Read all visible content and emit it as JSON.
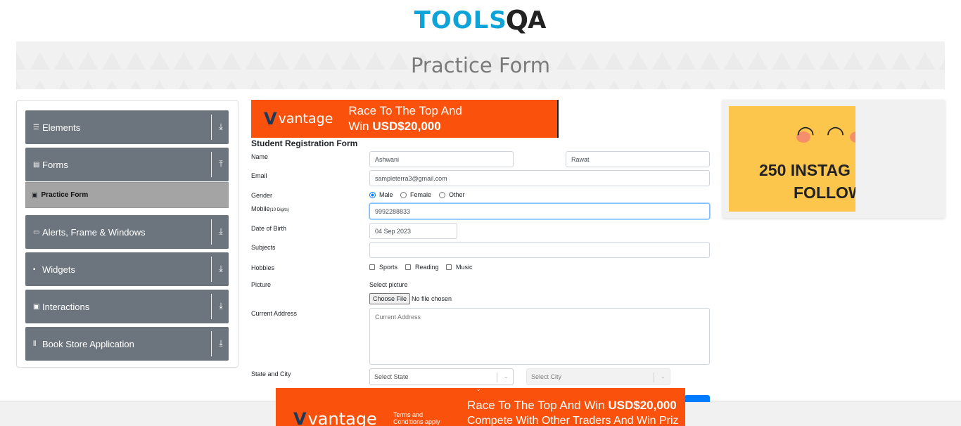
{
  "logo": {
    "part1": "TOOLS",
    "part2": "Q",
    "part3": "A"
  },
  "banner": {
    "title": "Practice Form"
  },
  "sidebar": {
    "groups": [
      {
        "label": "Elements",
        "icon": "list-icon",
        "arrow": "⤓"
      },
      {
        "label": "Forms",
        "icon": "form-icon",
        "arrow": "⤒"
      },
      {
        "label": "Alerts, Frame & Windows",
        "icon": "window-icon",
        "arrow": "⤓"
      },
      {
        "label": "Widgets",
        "icon": "widgets-icon",
        "arrow": "⤓"
      },
      {
        "label": "Interactions",
        "icon": "interactions-icon",
        "arrow": "⤓"
      },
      {
        "label": "Book Store Application",
        "icon": "books-icon",
        "arrow": "⤓"
      }
    ],
    "active_item": "Practice Form"
  },
  "ad_top": {
    "brand": "vantage",
    "line1": "Race To The Top And",
    "line2_prefix": "Win ",
    "line2_bold": "USD$20,000"
  },
  "form": {
    "title": "Student Registration Form",
    "name_label": "Name",
    "first_name": "Ashwani",
    "last_name": "Rawat",
    "email_label": "Email",
    "email": "sampleterra3@gmail.com",
    "gender_label": "Gender",
    "genders": [
      "Male",
      "Female",
      "Other"
    ],
    "gender_selected": "Male",
    "mobile_label": "Mobile",
    "mobile_hint": "(10 Digits)",
    "mobile": "9992288833",
    "dob_label": "Date of Birth",
    "dob": "04 Sep 2023",
    "subjects_label": "Subjects",
    "hobbies_label": "Hobbies",
    "hobbies": [
      "Sports",
      "Reading",
      "Music"
    ],
    "picture_label": "Picture",
    "select_picture": "Select picture",
    "choose_file": "Choose File",
    "no_file": "No file chosen",
    "address_label": "Current Address",
    "address_placeholder": "Current Address",
    "state_city_label": "State and City",
    "state_placeholder": "Select State",
    "city_placeholder": "Select City"
  },
  "ad_right": {
    "line1": "250 INSTAG",
    "line2": "FOLLOW"
  },
  "ad_bottom": {
    "brand": "vantage",
    "tnc1": "Terms and",
    "tnc2": "Conditions apply",
    "line1_prefix": "Race To The Top And Win ",
    "line1_bold": "USD$20,000",
    "line2": "Compete With Other Traders And Win Priz"
  },
  "colors": {
    "accent": "#0ea4d8",
    "sidebar": "#6c757d",
    "ad": "#fa520c",
    "focus": "#80bdff"
  }
}
